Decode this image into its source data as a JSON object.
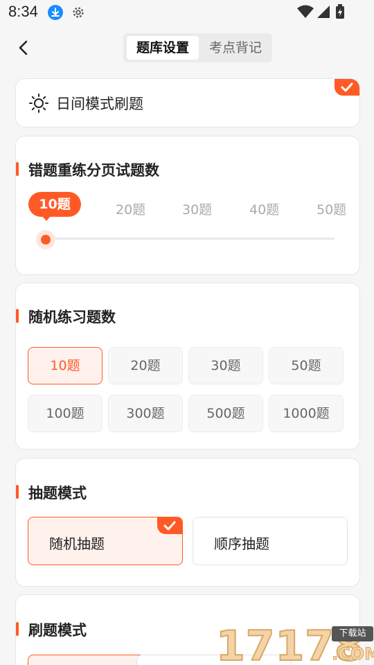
{
  "status_bar": {
    "time": "8:34"
  },
  "nav": {
    "tabs": [
      {
        "label": "题库设置",
        "active": true
      },
      {
        "label": "考点背记",
        "active": false
      }
    ]
  },
  "day_mode": {
    "label": "日间模式刷题",
    "checked": true
  },
  "wrong_practice": {
    "title": "错题重练分页试题数",
    "options": [
      "10题",
      "20题",
      "30题",
      "40题",
      "50题"
    ],
    "selected": "10题",
    "slider_level": 0
  },
  "random_practice": {
    "title": "随机练习题数",
    "options": [
      "10题",
      "20题",
      "30题",
      "50题",
      "100题",
      "300题",
      "500题",
      "1000题"
    ],
    "selected": "10题"
  },
  "draw_mode": {
    "title": "抽题模式",
    "options": [
      "随机抽题",
      "顺序抽题"
    ],
    "selected": "随机抽题"
  },
  "brush_mode": {
    "title": "刷题模式"
  },
  "watermark": {
    "digits": "17178",
    "tag": "下载站",
    "suffix": ".COM"
  },
  "colors": {
    "accent": "#ff5a26",
    "accent_light": "#fff1ec",
    "background": "#f6f6f6"
  }
}
